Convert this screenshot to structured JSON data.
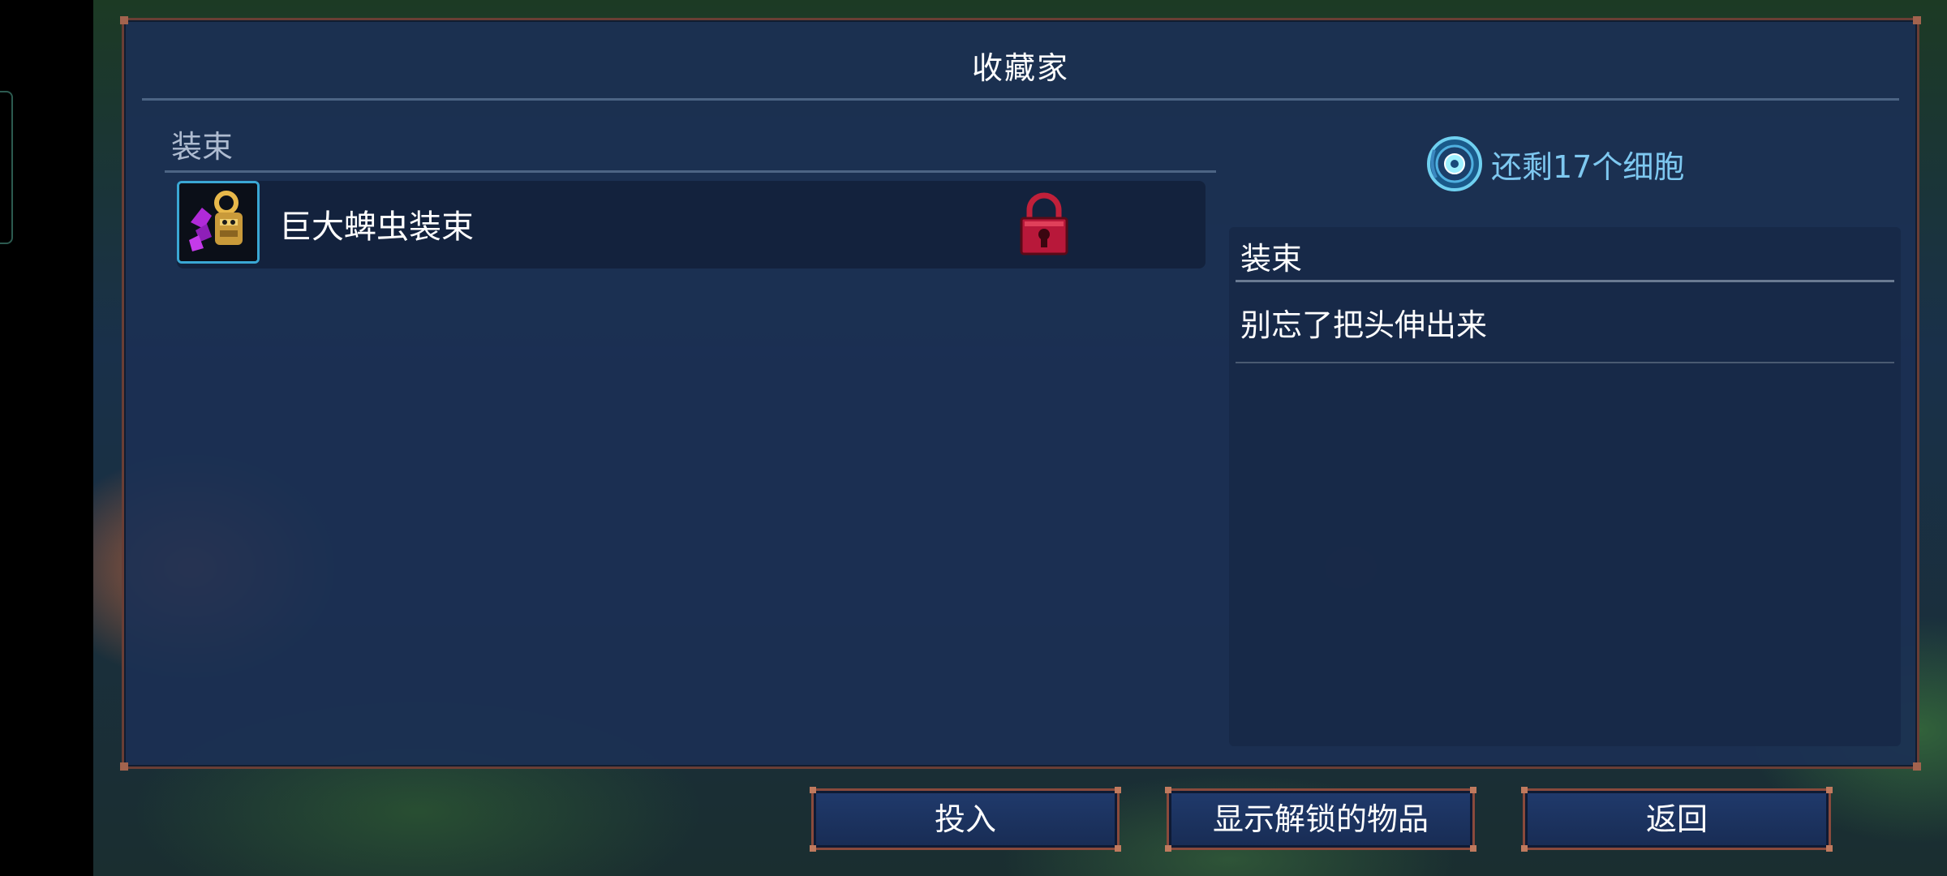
{
  "panel": {
    "title": "收藏家",
    "category_label": "装束"
  },
  "items": [
    {
      "name": "巨大蜱虫装束",
      "icon": "tick-outfit-icon",
      "locked": true
    }
  ],
  "cells": {
    "text": "还剩17个细胞",
    "icon": "cell-icon"
  },
  "description": {
    "heading": "装束",
    "text": "别忘了把头伸出来"
  },
  "buttons": {
    "invest": "投入",
    "show_unlocked": "显示解锁的物品",
    "back": "返回"
  },
  "colors": {
    "panel_bg": "#1b3054",
    "panel_border": "#6a3e35",
    "accent_text": "#7ec8f0",
    "lock": "#c0203a",
    "item_icon_border": "#3aa7d4"
  }
}
